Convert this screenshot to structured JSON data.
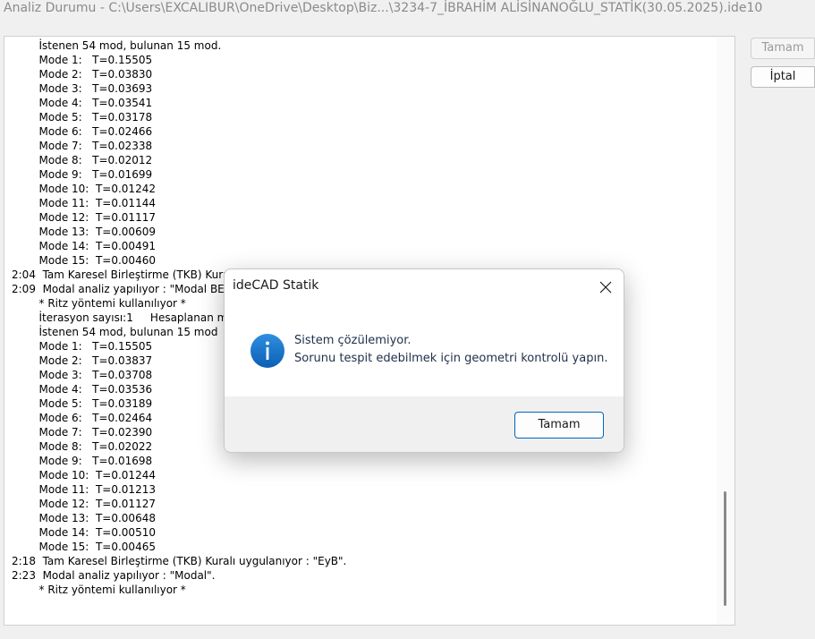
{
  "window": {
    "title": "Analiz Durumu - C:\\Users\\EXCALIBUR\\OneDrive\\Desktop\\Biz...\\3234-7_İBRAHİM ALİSİNANOĞLU_STATİK(30.05.2025).ide10"
  },
  "side_buttons": {
    "ok": "Tamam",
    "cancel": "İptal"
  },
  "log": [
    "        İstenen 54 mod, bulunan 15 mod.",
    "        Mode 1:   T=0.15505",
    "        Mode 2:   T=0.03830",
    "        Mode 3:   T=0.03693",
    "        Mode 4:   T=0.03541",
    "        Mode 5:   T=0.03178",
    "        Mode 6:   T=0.02466",
    "        Mode 7:   T=0.02338",
    "        Mode 8:   T=0.02012",
    "        Mode 9:   T=0.01699",
    "        Mode 10:  T=0.01242",
    "        Mode 11:  T=0.01144",
    "        Mode 12:  T=0.01117",
    "        Mode 13:  T=0.00609",
    "        Mode 14:  T=0.00491",
    "        Mode 15:  T=0.00460",
    "2:04  Tam Karesel Birleştirme (TKB) Kuralı",
    "2:09  Modal analiz yapılıyor : \"Modal BE4\"",
    "        * Ritz yöntemi kullanılıyor *",
    "        İterasyon sayısı:1     Hesaplanan m",
    "        İstenen 54 mod, bulunan 15 mod",
    "        Mode 1:   T=0.15505",
    "        Mode 2:   T=0.03837",
    "        Mode 3:   T=0.03708",
    "        Mode 4:   T=0.03536",
    "        Mode 5:   T=0.03189",
    "        Mode 6:   T=0.02464",
    "        Mode 7:   T=0.02390",
    "        Mode 8:   T=0.02022",
    "        Mode 9:   T=0.01698",
    "        Mode 10:  T=0.01244",
    "        Mode 11:  T=0.01213",
    "        Mode 12:  T=0.01127",
    "        Mode 13:  T=0.00648",
    "        Mode 14:  T=0.00510",
    "        Mode 15:  T=0.00465",
    "2:18  Tam Karesel Birleştirme (TKB) Kuralı uygulanıyor : \"EyB\".",
    "2:23  Modal analiz yapılıyor : \"Modal\".",
    "        * Ritz yöntemi kullanılıyor *"
  ],
  "dialog": {
    "title": "ideCAD Statik",
    "line1": "Sistem çözülemiyor.",
    "line2": "Sorunu tespit edebilmek için geometri kontrolü yapın.",
    "ok": "Tamam",
    "icon": "info-icon",
    "accent": "#0067c0"
  }
}
